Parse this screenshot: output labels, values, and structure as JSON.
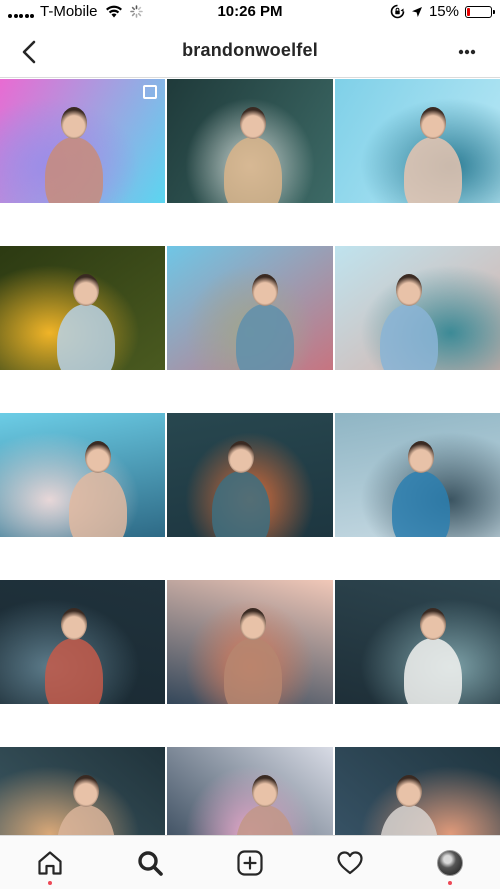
{
  "status_bar": {
    "carrier": "T-Mobile",
    "time": "10:26 PM",
    "battery_percent_label": "15%",
    "battery_level": 0.15,
    "signal_icon": "signal-dots-icon",
    "wifi_icon": "wifi-icon",
    "activity_icon": "loading-spinner-icon",
    "orientation_lock_icon": "orientation-lock-icon",
    "battery_color": "#e60000"
  },
  "header": {
    "username": "brandonwoelfel",
    "back_icon": "chevron-left-icon",
    "more_icon": "more-horizontal-icon"
  },
  "grid": {
    "rows": [
      [
        {
          "bg": [
            "#e96bd2",
            "#9b8de8",
            "#5bd6f0"
          ],
          "subject": "#c88c7a",
          "multi": true
        },
        {
          "bg": [
            "#1f3a3a",
            "#c9d2cf",
            "#3d6a66"
          ],
          "subject": "#d9b48a"
        },
        {
          "bg": [
            "#7fd0e8",
            "#2c7c94",
            "#b9e8f5"
          ],
          "subject": "#e6c4b0"
        }
      ],
      [
        {
          "bg": [
            "#2c3a12",
            "#f0b428",
            "#4a5a20"
          ],
          "subject": "#b7d1e6"
        },
        {
          "bg": [
            "#6fc6e6",
            "#9fa68f",
            "#c77480"
          ],
          "subject": "#5f8fab"
        },
        {
          "bg": [
            "#bfe3ee",
            "#3c8a96",
            "#d7b0a8"
          ],
          "subject": "#8ab4d6"
        }
      ],
      [
        {
          "bg": [
            "#6ccde6",
            "#e8d7d8",
            "#2e6a86"
          ],
          "subject": "#e1b9a0"
        },
        {
          "bg": [
            "#28474f",
            "#d66c3a",
            "#1d3640"
          ],
          "subject": "#3d6f80"
        },
        {
          "bg": [
            "#8fb5c4",
            "#3b5461",
            "#c7dae3"
          ],
          "subject": "#2b7fb0"
        }
      ],
      [
        {
          "bg": [
            "#20323c",
            "#5c7b8a",
            "#1a2a33"
          ],
          "subject": "#c45a4a"
        },
        {
          "bg": [
            "#f1c8b8",
            "#d67a5a",
            "#34475a"
          ],
          "subject": "#b68670"
        },
        {
          "bg": [
            "#2e4650",
            "#7da1a8",
            "#1e2f38"
          ],
          "subject": "#f2f2f0"
        }
      ],
      [
        {
          "bg": [
            "#20333b",
            "#d9a878",
            "#3f5c66"
          ],
          "subject": "#d9b49a"
        },
        {
          "bg": [
            "#d8dbe5",
            "#e4a6c8",
            "#2c3f52"
          ],
          "subject": "#c29787"
        },
        {
          "bg": [
            "#203640",
            "#e09a7a",
            "#3a566a"
          ],
          "subject": "#d8d4d0"
        }
      ]
    ]
  },
  "tab_bar": {
    "items": [
      {
        "name": "tab-home",
        "icon": "home-icon",
        "notification": true
      },
      {
        "name": "tab-search",
        "icon": "search-icon",
        "active": true
      },
      {
        "name": "tab-new-post",
        "icon": "plus-square-icon"
      },
      {
        "name": "tab-activity",
        "icon": "heart-icon"
      },
      {
        "name": "tab-profile",
        "icon": "profile-avatar-icon",
        "notification": true
      }
    ],
    "notification_dot_color": "#ed4956"
  }
}
